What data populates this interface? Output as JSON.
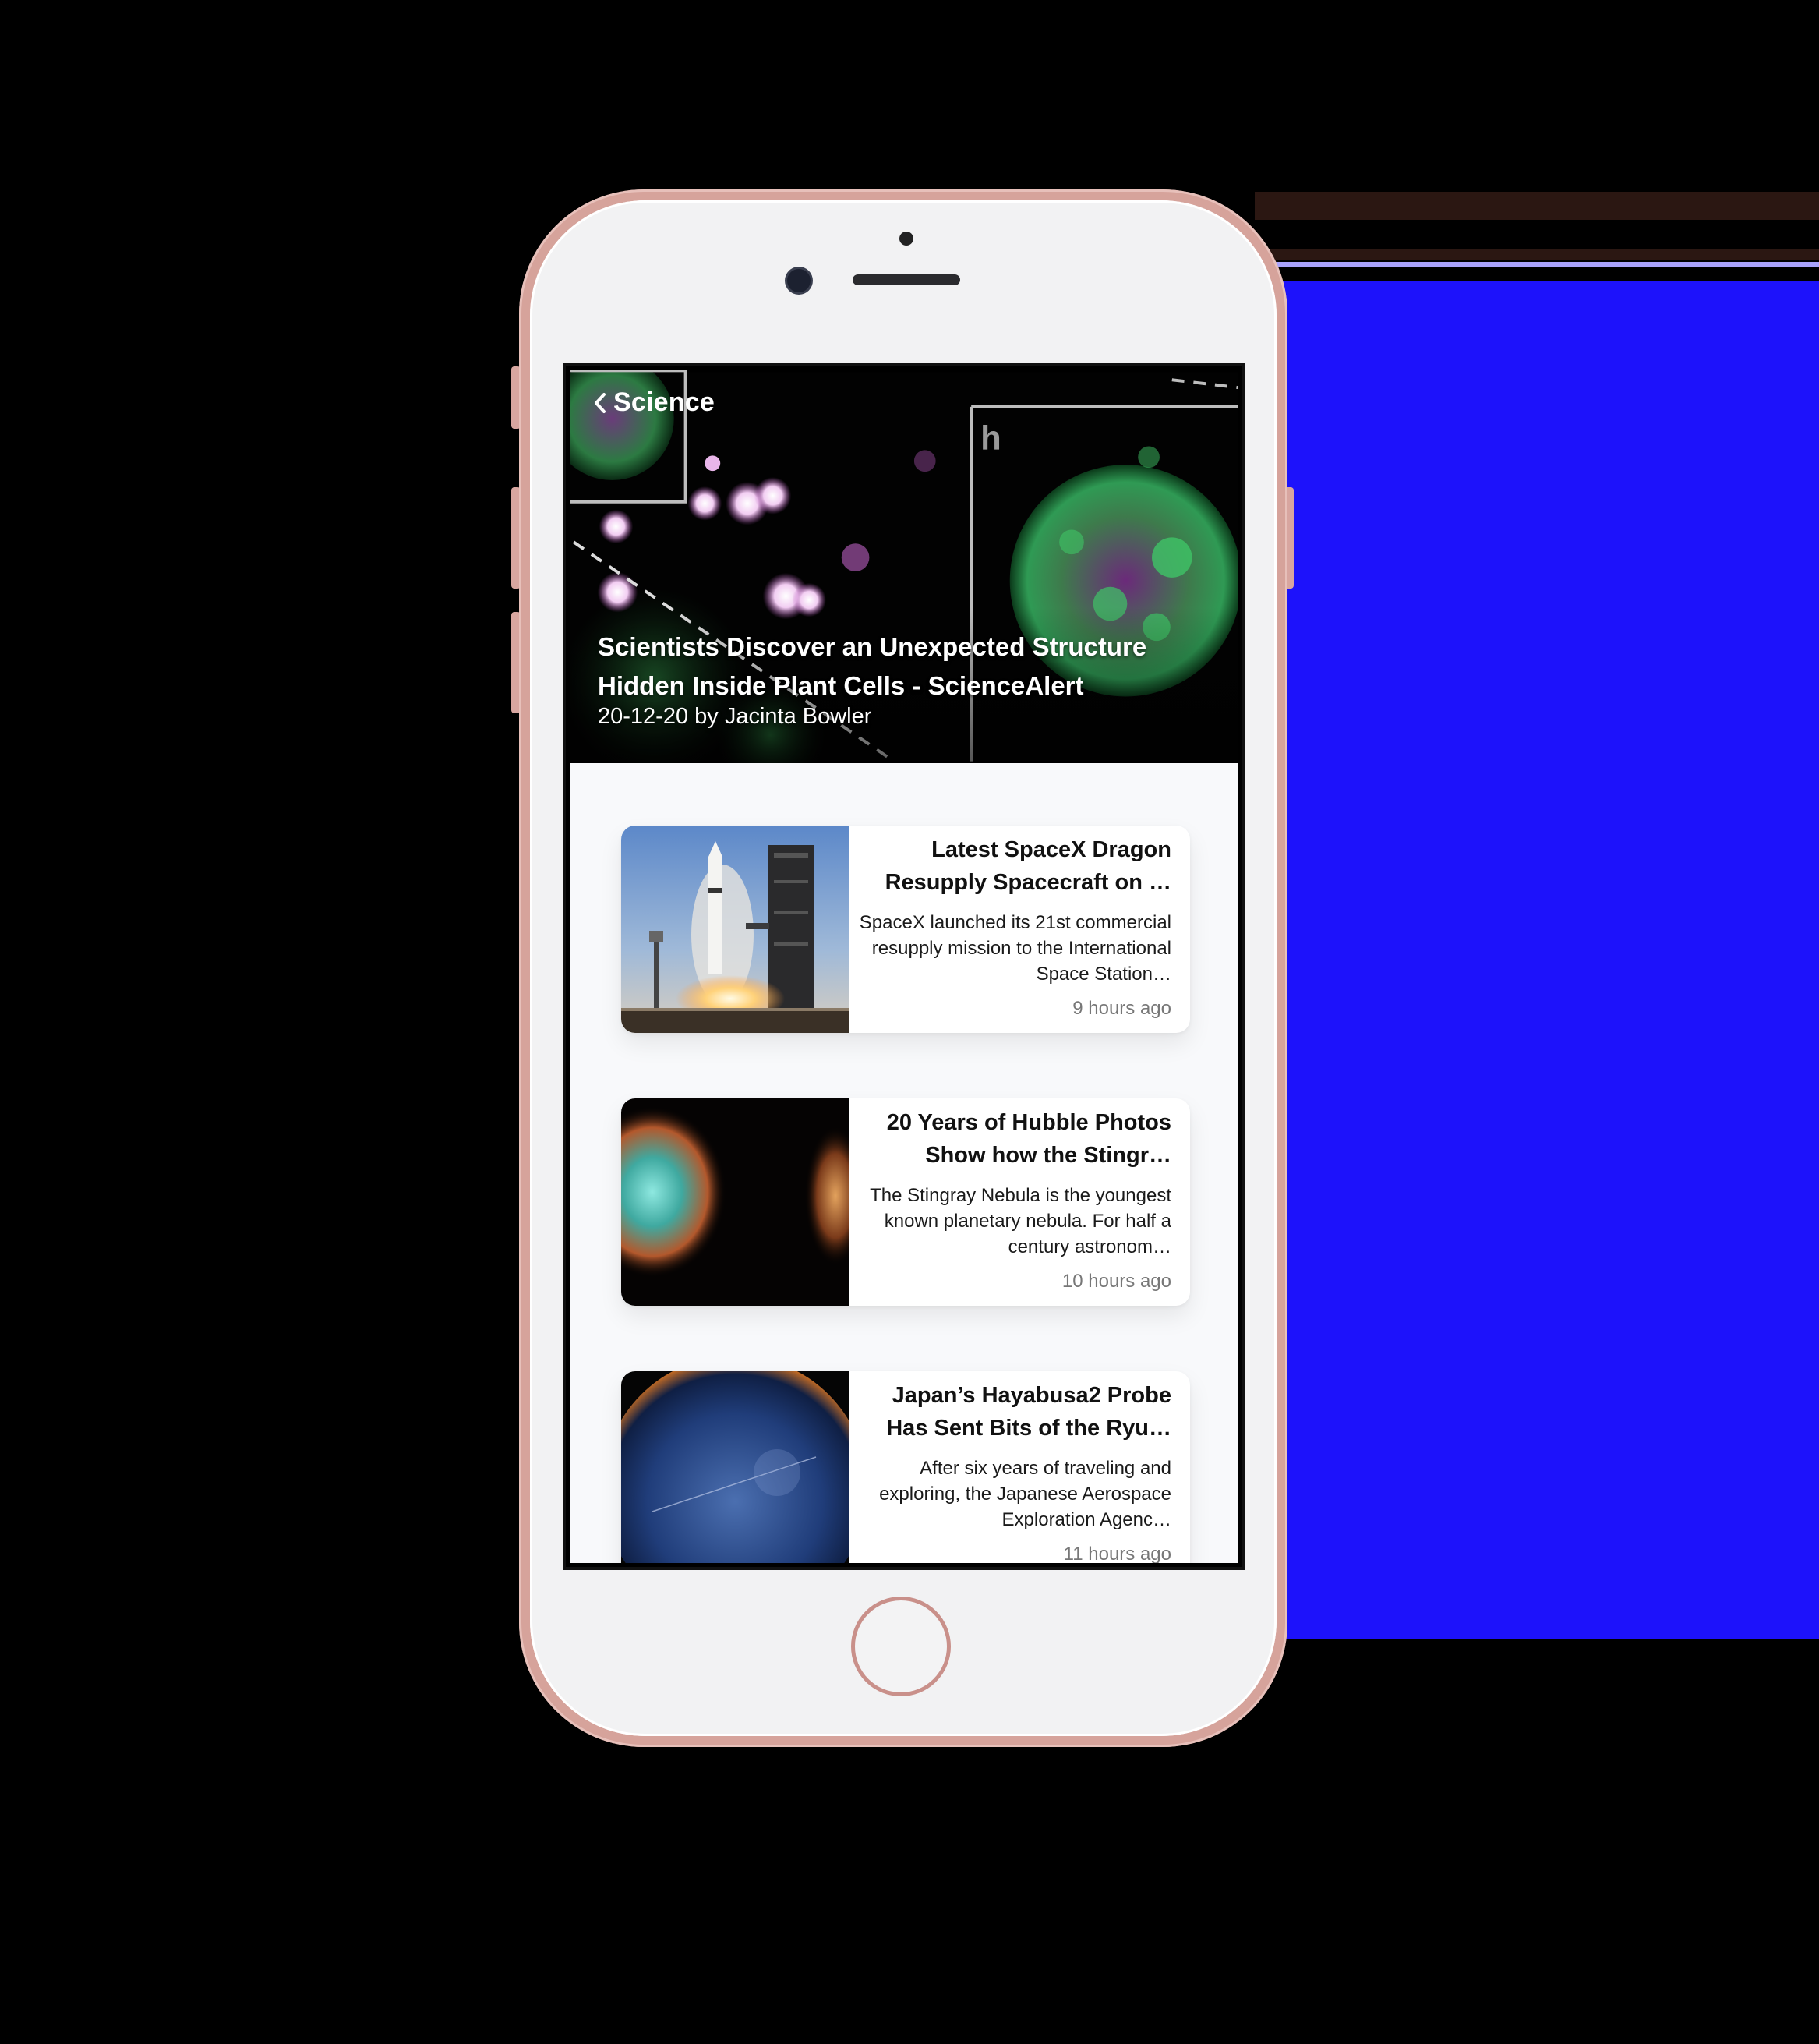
{
  "header": {
    "back_label": "Science",
    "back_icon": "chevron-left-icon"
  },
  "featured": {
    "title": "Scientists Discover an Unexpected Structure Hidden Inside Plant Cells - ScienceAlert",
    "meta": "20-12-20 by Jacinta Bowler",
    "panel_label": "h"
  },
  "articles": [
    {
      "title": "Latest SpaceX Dragon Resupply Spacecraft on …",
      "description": "SpaceX launched its 21st commercial resupply mission to the International Space Station…",
      "time": "9 hours ago"
    },
    {
      "title": "20 Years of Hubble Photos Show how the Stingr…",
      "description": "The Stingray Nebula is the youngest known planetary nebula. For half a century astronom…",
      "time": "10 hours ago"
    },
    {
      "title": "Japan’s Hayabusa2 Probe Has Sent Bits of the Ryu…",
      "description": "After six years of traveling and exploring, the Japanese Aerospace Exploration Agenc…",
      "time": "11 hours ago"
    }
  ],
  "colors": {
    "phone_frame": "#d6a39b",
    "screen_background": "#f8f9fb",
    "backdrop_accent": "#1d12fb",
    "muted_text": "#777777"
  }
}
